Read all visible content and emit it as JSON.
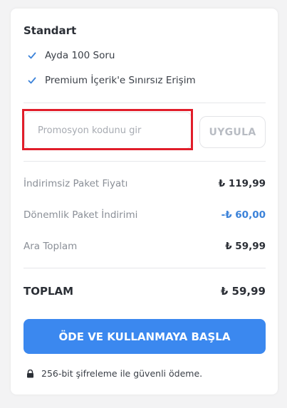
{
  "plan": {
    "title": "Standart",
    "features": [
      "Ayda 100 Soru",
      "Premium İçerik'e Sınırsız Erişim"
    ]
  },
  "promo": {
    "placeholder": "Promosyon kodunu gir",
    "apply_label": "UYGULA"
  },
  "summary": {
    "rows": [
      {
        "label": "İndirimsiz Paket Fiyatı",
        "value": "₺ 119,99"
      },
      {
        "label": "Dönemlik Paket İndirimi",
        "value": "-₺ 60,00"
      },
      {
        "label": "Ara Toplam",
        "value": "₺ 59,99"
      }
    ],
    "total_label": "TOPLAM",
    "total_value": "₺ 59,99"
  },
  "cta": {
    "label": "ÖDE VE KULLANMAYA BAŞLA"
  },
  "security": {
    "text": "256-bit şifreleme ile güvenli ödeme."
  },
  "colors": {
    "accent": "#3b88ef",
    "discount": "#3b82d9",
    "highlight": "#e11d2a",
    "check": "#3b82d9"
  }
}
